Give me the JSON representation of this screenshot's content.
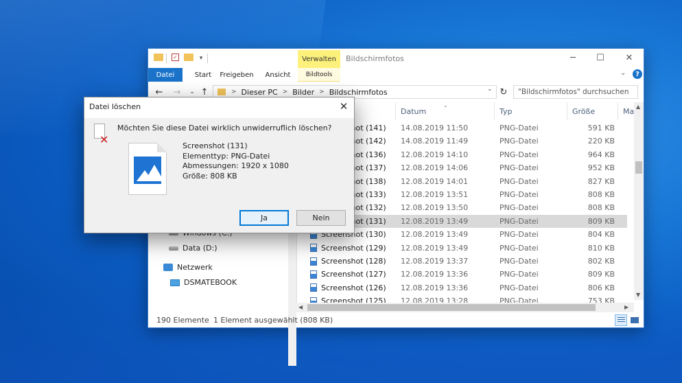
{
  "explorer": {
    "title": "Bildschirmfotos",
    "quick_access_dropdown": "▾",
    "ribbon_tabs": {
      "verwalten": "Verwalten",
      "file": "Datei",
      "start": "Start",
      "share": "Freigeben",
      "view": "Ansicht",
      "tools": "Bildtools"
    },
    "address": {
      "crumbs": [
        "Dieser PC",
        "Bilder",
        "Bildschirmfotos"
      ]
    },
    "search": {
      "placeholder": "\"Bildschirmfotos\" durchsuchen"
    },
    "nav_pane": [
      {
        "label": "Windows (C:)",
        "icon": "drive-icon"
      },
      {
        "label": "Data (D:)",
        "icon": "drive-icon"
      },
      {
        "label": "Netzwerk",
        "icon": "network-icon"
      },
      {
        "label": "DSMATEBOOK",
        "icon": "computer-icon"
      }
    ],
    "columns": {
      "date": "Datum",
      "type": "Typ",
      "size": "Größe",
      "more": "Ma"
    },
    "files": [
      {
        "name": "Screenshot (141)",
        "date": "14.08.2019 11:50",
        "type": "PNG-Datei",
        "size": "591 KB"
      },
      {
        "name": "Screenshot (142)",
        "date": "14.08.2019 11:49",
        "type": "PNG-Datei",
        "size": "220 KB"
      },
      {
        "name": "Screenshot (136)",
        "date": "12.08.2019 14:10",
        "type": "PNG-Datei",
        "size": "964 KB"
      },
      {
        "name": "Screenshot (137)",
        "date": "12.08.2019 14:06",
        "type": "PNG-Datei",
        "size": "952 KB"
      },
      {
        "name": "Screenshot (138)",
        "date": "12.08.2019 14:01",
        "type": "PNG-Datei",
        "size": "827 KB"
      },
      {
        "name": "Screenshot (133)",
        "date": "12.08.2019 13:51",
        "type": "PNG-Datei",
        "size": "808 KB"
      },
      {
        "name": "Screenshot (132)",
        "date": "12.08.2019 13:50",
        "type": "PNG-Datei",
        "size": "808 KB"
      },
      {
        "name": "Screenshot (131)",
        "date": "12.08.2019 13:49",
        "type": "PNG-Datei",
        "size": "809 KB",
        "selected": true
      },
      {
        "name": "Screenshot (130)",
        "date": "12.08.2019 13:49",
        "type": "PNG-Datei",
        "size": "804 KB"
      },
      {
        "name": "Screenshot (129)",
        "date": "12.08.2019 13:49",
        "type": "PNG-Datei",
        "size": "810 KB"
      },
      {
        "name": "Screenshot (128)",
        "date": "12.08.2019 13:37",
        "type": "PNG-Datei",
        "size": "802 KB"
      },
      {
        "name": "Screenshot (127)",
        "date": "12.08.2019 13:36",
        "type": "PNG-Datei",
        "size": "809 KB"
      },
      {
        "name": "Screenshot (126)",
        "date": "12.08.2019 13:36",
        "type": "PNG-Datei",
        "size": "806 KB"
      },
      {
        "name": "Screenshot (125)",
        "date": "12.08.2019 13:28",
        "type": "PNG-Datei",
        "size": "753 KB"
      }
    ],
    "status": {
      "count": "190 Elemente",
      "selection": "1 Element ausgewählt (808 KB)"
    }
  },
  "dialog": {
    "title": "Datei löschen",
    "question": "Möchten Sie diese Datei wirklich unwiderruflich löschen?",
    "file_name": "Screenshot (131)",
    "file_type": "Elementtyp: PNG-Datei",
    "dimensions": "Abmessungen: 1920 x 1080",
    "size": "Größe: 808 KB",
    "yes_label": "Ja",
    "no_label": "Nein"
  },
  "colors": {
    "accent": "#0078d7",
    "ribbon_file": "#1a73c9",
    "verwalten_highlight": "#fdf17c",
    "delete_x": "#d01b1b"
  }
}
